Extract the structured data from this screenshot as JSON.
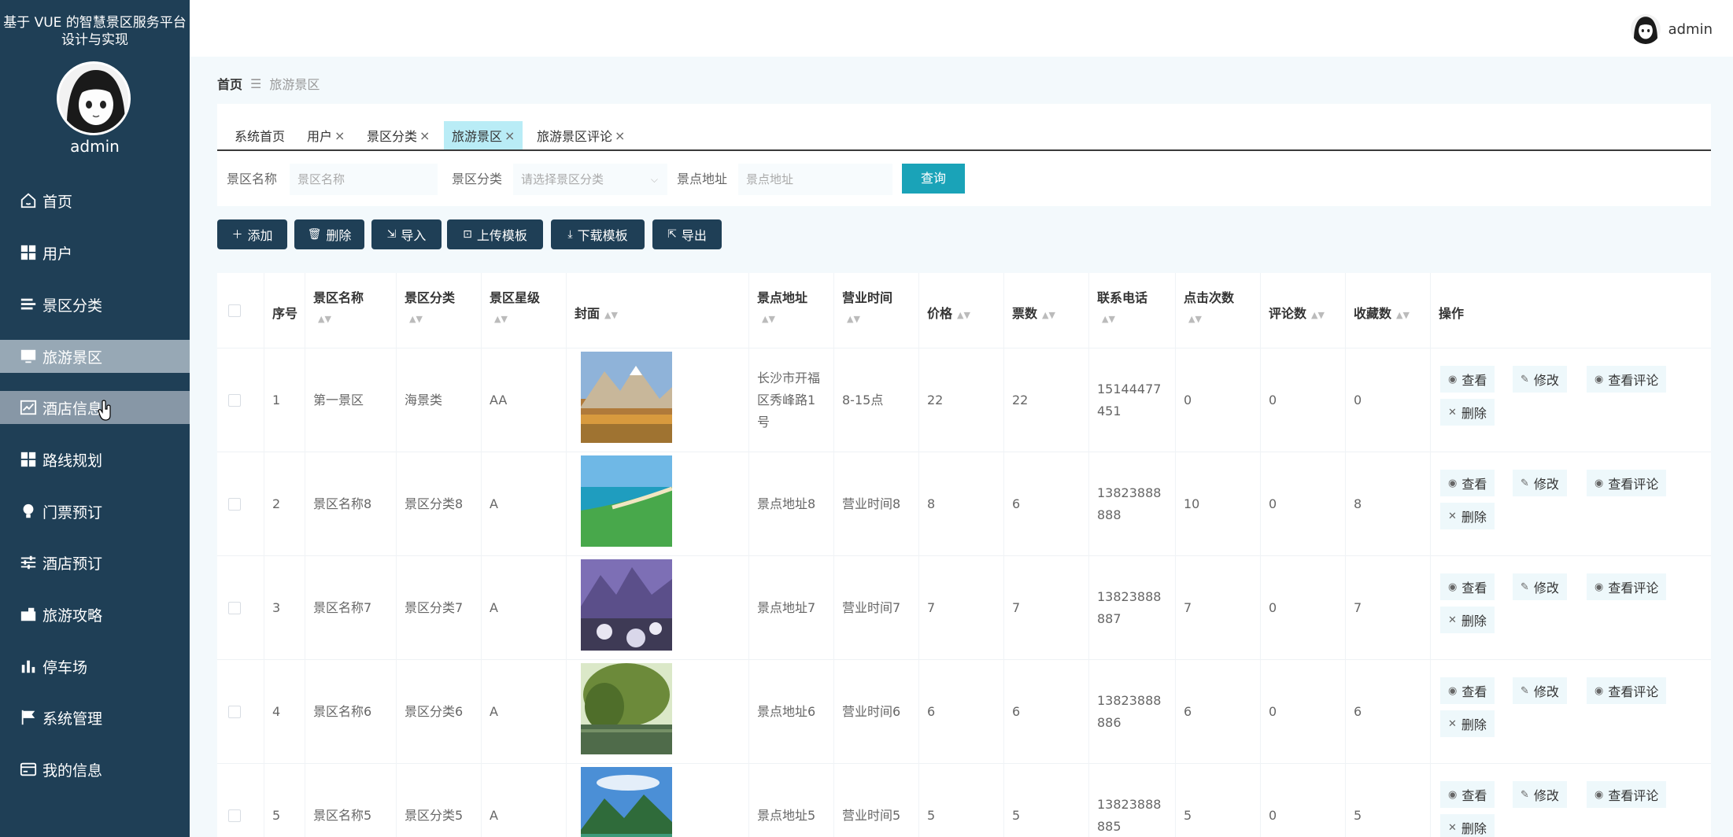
{
  "app": {
    "title": "基于 VUE 的智慧景区服务平台设计与实现",
    "username": "admin"
  },
  "sidebar": {
    "items": [
      {
        "label": "首页",
        "icon": "home-icon"
      },
      {
        "label": "用户",
        "icon": "grid-icon"
      },
      {
        "label": "景区分类",
        "icon": "list-icon"
      },
      {
        "label": "旅游景区",
        "icon": "monitor-icon"
      },
      {
        "label": "酒店信息",
        "icon": "chart-icon"
      },
      {
        "label": "路线规划",
        "icon": "grid-icon"
      },
      {
        "label": "门票预订",
        "icon": "bulb-icon"
      },
      {
        "label": "酒店预订",
        "icon": "sliders-icon"
      },
      {
        "label": "旅游攻略",
        "icon": "camera-icon"
      },
      {
        "label": "停车场",
        "icon": "bars-icon"
      },
      {
        "label": "系统管理",
        "icon": "flag-icon"
      },
      {
        "label": "我的信息",
        "icon": "card-icon"
      }
    ]
  },
  "topbar": {
    "username": "admin"
  },
  "breadcrumb": {
    "home": "首页",
    "sep": "☰",
    "current": "旅游景区"
  },
  "tabs": [
    {
      "label": "系统首页",
      "closable": false
    },
    {
      "label": "用户",
      "closable": true
    },
    {
      "label": "景区分类",
      "closable": true
    },
    {
      "label": "旅游景区",
      "closable": true
    },
    {
      "label": "旅游景区评论",
      "closable": true
    }
  ],
  "filters": {
    "name_label": "景区名称",
    "name_placeholder": "景区名称",
    "category_label": "景区分类",
    "category_placeholder": "请选择景区分类",
    "address_label": "景点地址",
    "address_placeholder": "景点地址",
    "query_button": "查询"
  },
  "toolbar": {
    "add": "添加",
    "delete": "删除",
    "import": "导入",
    "upload_template": "上传模板",
    "download_template": "下载模板",
    "export": "导出"
  },
  "table": {
    "headers": {
      "index": "序号",
      "name": "景区名称",
      "category": "景区分类",
      "star": "景区星级",
      "cover": "封面",
      "address": "景点地址",
      "hours": "营业时间",
      "price": "价格",
      "tickets": "票数",
      "phone": "联系电话",
      "clicks": "点击次数",
      "comments": "评论数",
      "favorites": "收藏数",
      "actions": "操作"
    },
    "actions": {
      "view": "查看",
      "edit": "修改",
      "view_comments": "查看评论",
      "delete": "删除"
    },
    "rows": [
      {
        "index": "1",
        "name": "第一景区",
        "category": "海景类",
        "star": "AA",
        "address": "长沙市开福区秀峰路1号",
        "hours": "8-15点",
        "price": "22",
        "tickets": "22",
        "phone": "15144477451",
        "clicks": "0",
        "comments": "0",
        "favorites": "0"
      },
      {
        "index": "2",
        "name": "景区名称8",
        "category": "景区分类8",
        "star": "A",
        "address": "景点地址8",
        "hours": "营业时间8",
        "price": "8",
        "tickets": "6",
        "phone": "13823888888",
        "clicks": "10",
        "comments": "0",
        "favorites": "8"
      },
      {
        "index": "3",
        "name": "景区名称7",
        "category": "景区分类7",
        "star": "A",
        "address": "景点地址7",
        "hours": "营业时间7",
        "price": "7",
        "tickets": "7",
        "phone": "13823888887",
        "clicks": "7",
        "comments": "0",
        "favorites": "7"
      },
      {
        "index": "4",
        "name": "景区名称6",
        "category": "景区分类6",
        "star": "A",
        "address": "景点地址6",
        "hours": "营业时间6",
        "price": "6",
        "tickets": "6",
        "phone": "13823888886",
        "clicks": "6",
        "comments": "0",
        "favorites": "6"
      },
      {
        "index": "5",
        "name": "景区名称5",
        "category": "景区分类5",
        "star": "A",
        "address": "景点地址5",
        "hours": "营业时间5",
        "price": "5",
        "tickets": "5",
        "phone": "13823888885",
        "clicks": "5",
        "comments": "0",
        "favorites": "5"
      }
    ]
  },
  "colors": {
    "sidebar": "#1f3f56",
    "accent": "#1aa3b8",
    "active_tab": "#b9ecf6"
  }
}
